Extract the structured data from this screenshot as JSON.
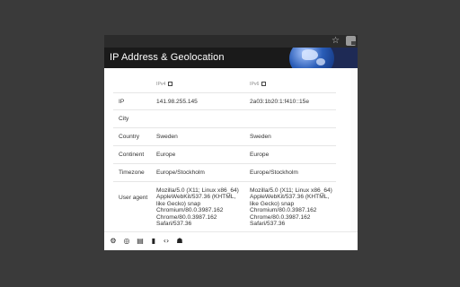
{
  "app": {
    "title": "IP Address & Geolocation"
  },
  "browser": {
    "star_icon": "star-icon",
    "extension_icon": "puzzle-icon"
  },
  "table": {
    "headers": {
      "v4": "IPv4",
      "v6": "IPv6"
    },
    "rows": [
      {
        "label": "IP",
        "v4": "141.98.255.145",
        "v6": "2a03:1b20:1:f410::15e"
      },
      {
        "label": "City",
        "v4": "",
        "v6": ""
      },
      {
        "label": "Country",
        "v4": "Sweden",
        "v6": "Sweden"
      },
      {
        "label": "Continent",
        "v4": "Europe",
        "v6": "Europe"
      },
      {
        "label": "Timezone",
        "v4": "Europe/Stockholm",
        "v6": "Europe/Stockholm"
      },
      {
        "label": "User agent",
        "v4": "Mozilla/5.0 (X11; Linux x86_64) AppleWebKit/537.36 (KHTML, like Gecko) snap Chromium/80.0.3987.162 Chrome/80.0.3987.162 Safari/537.36",
        "v6": "Mozilla/5.0 (X11; Linux x86_64) AppleWebKit/537.36 (KHTML, like Gecko) snap Chromium/80.0.3987.162 Chrome/80.0.3987.162 Safari/537.36"
      }
    ]
  },
  "toolbar": {
    "icons": [
      "gear-icon",
      "fingerprint-icon",
      "document-icon",
      "bar-chart-icon",
      "code-icon",
      "android-icon"
    ]
  },
  "colors": {
    "header_bg": "#1a1a1a",
    "page_bg": "#3a3a3a",
    "accent": "#2a5db8"
  }
}
